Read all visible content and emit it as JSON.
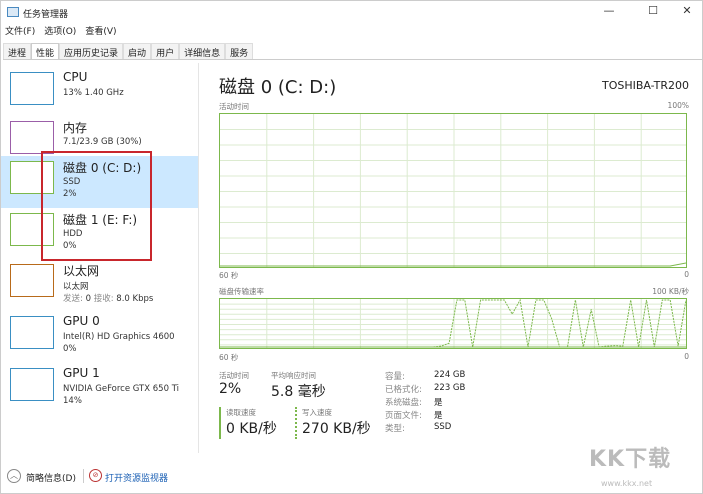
{
  "window": {
    "title": "任务管理器",
    "min": "—",
    "max": "☐",
    "close": "✕"
  },
  "menu": [
    "文件(F)",
    "选项(O)",
    "查看(V)"
  ],
  "tabs": [
    "进程",
    "性能",
    "应用历史记录",
    "启动",
    "用户",
    "详细信息",
    "服务"
  ],
  "active_tab": 1,
  "sidebar": [
    {
      "name": "CPU",
      "sub1": "13% 1.40 GHz",
      "sub2": "",
      "color": "#3a8fc3"
    },
    {
      "name": "内存",
      "sub1": "7.1/23.9 GB (30%)",
      "sub2": "",
      "color": "#9b5ea8"
    },
    {
      "name": "磁盘 0 (C: D:)",
      "sub1": "SSD",
      "sub2": "2%",
      "color": "#7cb84c"
    },
    {
      "name": "磁盘 1 (E: F:)",
      "sub1": "HDD",
      "sub2": "0%",
      "color": "#7cb84c"
    },
    {
      "name": "以太网",
      "sub1": "以太网",
      "sub2": "",
      "sub_net": {
        "send_label": "发送:",
        "send": "0",
        "recv_label": "接收:",
        "recv": "8.0 Kbps"
      },
      "color": "#b86a1a"
    },
    {
      "name": "GPU 0",
      "sub1": "Intel(R) HD Graphics 4600",
      "sub2": "0%",
      "color": "#3a8fc3"
    },
    {
      "name": "GPU 1",
      "sub1": "NVIDIA GeForce GTX 650 Ti",
      "sub2": "14%",
      "color": "#3a8fc3"
    }
  ],
  "main": {
    "title": "磁盘 0 (C: D:)",
    "model": "TOSHIBA-TR200",
    "chart1": {
      "label": "活动时间",
      "max": "100%",
      "xleft": "60 秒",
      "xright": "0"
    },
    "chart2": {
      "label": "磁盘传输速率",
      "max": "100 KB/秒",
      "xleft": "60 秒",
      "xright": "0"
    },
    "stats": {
      "active_label": "活动时间",
      "active": "2%",
      "resp_label": "平均响应时间",
      "resp": "5.8 毫秒",
      "read_label": "读取速度",
      "read": "0 KB/秒",
      "write_label": "写入速度",
      "write": "270 KB/秒"
    },
    "props": [
      [
        "容量:",
        "224 GB"
      ],
      [
        "已格式化:",
        "223 GB"
      ],
      [
        "系统磁盘:",
        "是"
      ],
      [
        "页面文件:",
        "是"
      ],
      [
        "类型:",
        "SSD"
      ]
    ]
  },
  "footer": {
    "less": "简略信息(D)",
    "monitor": "打开资源监视器"
  },
  "watermark": {
    "main": "KK下载",
    "url": "www.kkx.net"
  },
  "chart_data": {
    "type": "line",
    "activity": [
      0,
      0,
      0,
      0,
      0,
      0,
      0,
      0,
      0,
      0,
      0,
      0,
      0,
      0,
      0,
      0,
      0,
      0,
      0,
      0,
      0,
      0,
      0,
      0,
      0,
      0,
      0,
      0,
      0,
      0,
      0,
      0,
      0,
      0,
      0,
      0,
      0,
      0,
      0,
      0,
      0,
      0,
      0,
      0,
      0,
      0,
      0,
      0,
      0,
      0,
      0,
      0,
      0,
      0,
      0,
      0,
      0,
      0,
      1,
      2
    ],
    "write_kbps": [
      0,
      0,
      0,
      0,
      0,
      0,
      0,
      0,
      0,
      0,
      0,
      0,
      0,
      0,
      0,
      0,
      0,
      0,
      0,
      0,
      0,
      0,
      0,
      0,
      0,
      0,
      0,
      0,
      2,
      8,
      100,
      100,
      0,
      100,
      100,
      100,
      100,
      70,
      100,
      0,
      100,
      100,
      60,
      0,
      0,
      100,
      0,
      80,
      0,
      2,
      3,
      2,
      100,
      0,
      100,
      0,
      100,
      100,
      2,
      100
    ],
    "ymax_kbps": 100
  }
}
